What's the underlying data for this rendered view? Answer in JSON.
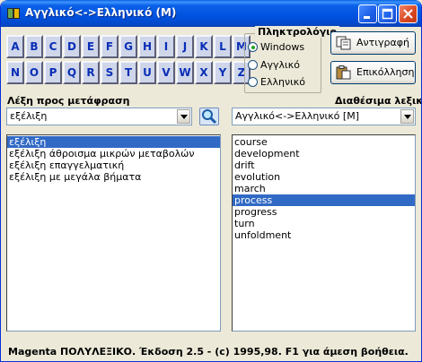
{
  "window": {
    "title": "Αγγλικό<->Ελληνικό (M)",
    "controls": [
      "minimize",
      "maximize",
      "close"
    ]
  },
  "keyboard": {
    "letters_row1": [
      "A",
      "B",
      "C",
      "D",
      "E",
      "F",
      "G",
      "H",
      "I",
      "J",
      "K",
      "L",
      "M"
    ],
    "letters_row2": [
      "N",
      "O",
      "P",
      "Q",
      "R",
      "S",
      "T",
      "U",
      "V",
      "W",
      "X",
      "Y",
      "Z"
    ]
  },
  "keyboard_group": {
    "legend": "Πληκτρολόγιο",
    "options": [
      {
        "label": "Windows",
        "checked": true
      },
      {
        "label": "Αγγλικό",
        "checked": false
      },
      {
        "label": "Ελληνικό",
        "checked": false
      }
    ]
  },
  "buttons": {
    "copy_label": "Αντιγραφή",
    "paste_label": "Επικόλληση"
  },
  "search": {
    "label": "Λέξη προς μετάφραση",
    "value": "εξέλιξη",
    "button_icon": "magnifier-icon"
  },
  "dictionaries": {
    "label": "Διαθέσιμα λεξικά",
    "selected": "Αγγλικό<->Ελληνικό [M]"
  },
  "greek_list": {
    "items": [
      "εξέλιξη",
      "εξέλιξη άθροισμα μικρών μεταβολών",
      "εξέλιξη επαγγελματική",
      "εξέλιξη με μεγάλα βήματα"
    ],
    "selected_index": 0
  },
  "english_list": {
    "items": [
      "course",
      "development",
      "drift",
      "evolution",
      "march",
      "process",
      "progress",
      "turn",
      "unfoldment"
    ],
    "selected_index": 5
  },
  "status": {
    "text": "Magenta ΠΟΛΥΛΕΞΙΚΟ. Έκδοση 2.5 - (c) 1995,98. F1 για άμεση βοήθεια."
  },
  "colors": {
    "titlebar": "#0054e3",
    "selection": "#316ac5",
    "letter_text": "#0a2fb6",
    "window_bg": "#ece9d8"
  }
}
